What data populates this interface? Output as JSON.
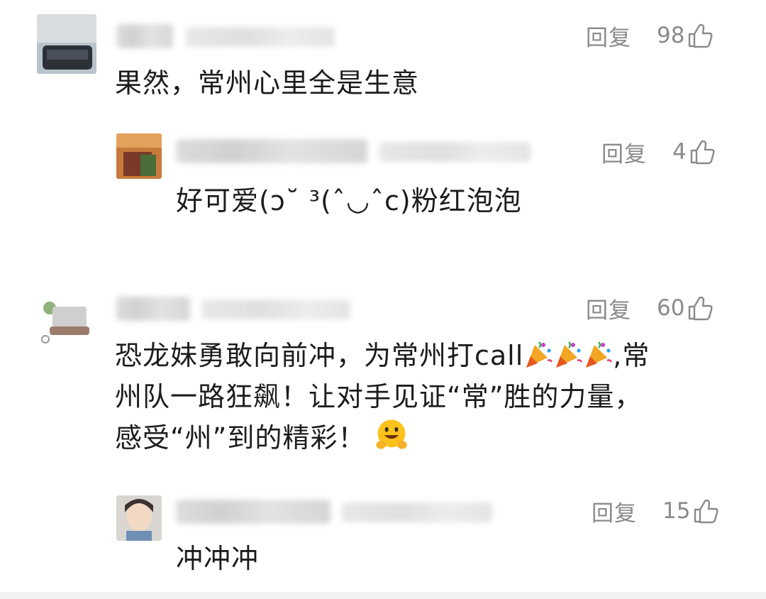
{
  "comments": [
    {
      "id": "c1",
      "level": "top",
      "reply_label": "回复",
      "likes": "98",
      "text": "果然，常州心里全是生意"
    },
    {
      "id": "c1r1",
      "level": "reply",
      "reply_label": "回复",
      "likes": "4",
      "text": "好可爱(ɔ˘ ³(ˆ◡ˆc)粉红泡泡"
    },
    {
      "id": "c2",
      "level": "top",
      "reply_label": "回复",
      "likes": "60",
      "text_lines": [
        "恐龙妹勇敢向前冲，为常州打call",
        ",常",
        "州队一路狂飙！让对手见证“常”胜的力量，",
        "感受“州”到的精彩！"
      ]
    },
    {
      "id": "c2r1",
      "level": "reply",
      "reply_label": "回复",
      "likes": "15",
      "text": "冲冲冲"
    }
  ],
  "icons": {
    "like": "thumbs-up-icon",
    "party": "party-popper-emoji",
    "smile": "grinning-hands-emoji"
  },
  "colors": {
    "meta_gray": "#8a8a8a",
    "text": "#1c1c1c",
    "background": "#ffffff"
  }
}
